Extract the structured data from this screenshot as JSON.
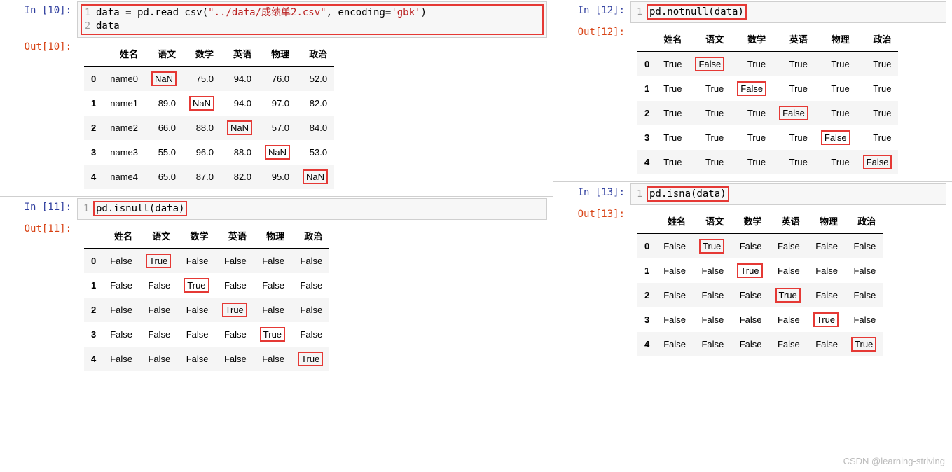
{
  "watermark": "CSDN @learning-striving",
  "cells": {
    "c10": {
      "in_label": "In  [10]:",
      "out_label": "Out[10]:",
      "code_lines": [
        {
          "n": "1",
          "pre": "data = pd.read_csv(",
          "str": "\"../data/成绩单2.csv\"",
          "mid": ", encoding=",
          "str2": "'gbk'",
          "post": ")"
        },
        {
          "n": "2",
          "pre": "data"
        }
      ],
      "cols": [
        "姓名",
        "语文",
        "数学",
        "英语",
        "物理",
        "政治"
      ],
      "rows": [
        {
          "i": "0",
          "v": [
            "name0",
            "NaN",
            "75.0",
            "94.0",
            "76.0",
            "52.0"
          ],
          "hl": [
            1
          ]
        },
        {
          "i": "1",
          "v": [
            "name1",
            "89.0",
            "NaN",
            "94.0",
            "97.0",
            "82.0"
          ],
          "hl": [
            2
          ]
        },
        {
          "i": "2",
          "v": [
            "name2",
            "66.0",
            "88.0",
            "NaN",
            "57.0",
            "84.0"
          ],
          "hl": [
            3
          ]
        },
        {
          "i": "3",
          "v": [
            "name3",
            "55.0",
            "96.0",
            "88.0",
            "NaN",
            "53.0"
          ],
          "hl": [
            4
          ]
        },
        {
          "i": "4",
          "v": [
            "name4",
            "65.0",
            "87.0",
            "82.0",
            "95.0",
            "NaN"
          ],
          "hl": [
            5
          ]
        }
      ]
    },
    "c11": {
      "in_label": "In  [11]:",
      "out_label": "Out[11]:",
      "code_lines": [
        {
          "n": "1",
          "pre": "pd.isnull(data)"
        }
      ],
      "cols": [
        "姓名",
        "语文",
        "数学",
        "英语",
        "物理",
        "政治"
      ],
      "rows": [
        {
          "i": "0",
          "v": [
            "False",
            "True",
            "False",
            "False",
            "False",
            "False"
          ],
          "hl": [
            1
          ]
        },
        {
          "i": "1",
          "v": [
            "False",
            "False",
            "True",
            "False",
            "False",
            "False"
          ],
          "hl": [
            2
          ]
        },
        {
          "i": "2",
          "v": [
            "False",
            "False",
            "False",
            "True",
            "False",
            "False"
          ],
          "hl": [
            3
          ]
        },
        {
          "i": "3",
          "v": [
            "False",
            "False",
            "False",
            "False",
            "True",
            "False"
          ],
          "hl": [
            4
          ]
        },
        {
          "i": "4",
          "v": [
            "False",
            "False",
            "False",
            "False",
            "False",
            "True"
          ],
          "hl": [
            5
          ]
        }
      ]
    },
    "c12": {
      "in_label": "In  [12]:",
      "out_label": "Out[12]:",
      "code_lines": [
        {
          "n": "1",
          "pre": "pd.notnull(data)"
        }
      ],
      "cols": [
        "姓名",
        "语文",
        "数学",
        "英语",
        "物理",
        "政治"
      ],
      "rows": [
        {
          "i": "0",
          "v": [
            "True",
            "False",
            "True",
            "True",
            "True",
            "True"
          ],
          "hl": [
            1
          ]
        },
        {
          "i": "1",
          "v": [
            "True",
            "True",
            "False",
            "True",
            "True",
            "True"
          ],
          "hl": [
            2
          ]
        },
        {
          "i": "2",
          "v": [
            "True",
            "True",
            "True",
            "False",
            "True",
            "True"
          ],
          "hl": [
            3
          ]
        },
        {
          "i": "3",
          "v": [
            "True",
            "True",
            "True",
            "True",
            "False",
            "True"
          ],
          "hl": [
            4
          ]
        },
        {
          "i": "4",
          "v": [
            "True",
            "True",
            "True",
            "True",
            "True",
            "False"
          ],
          "hl": [
            5
          ]
        }
      ]
    },
    "c13": {
      "in_label": "In  [13]:",
      "out_label": "Out[13]:",
      "code_lines": [
        {
          "n": "1",
          "pre": "pd.isna(data)"
        }
      ],
      "cols": [
        "姓名",
        "语文",
        "数学",
        "英语",
        "物理",
        "政治"
      ],
      "rows": [
        {
          "i": "0",
          "v": [
            "False",
            "True",
            "False",
            "False",
            "False",
            "False"
          ],
          "hl": [
            1
          ]
        },
        {
          "i": "1",
          "v": [
            "False",
            "False",
            "True",
            "False",
            "False",
            "False"
          ],
          "hl": [
            2
          ]
        },
        {
          "i": "2",
          "v": [
            "False",
            "False",
            "False",
            "True",
            "False",
            "False"
          ],
          "hl": [
            3
          ]
        },
        {
          "i": "3",
          "v": [
            "False",
            "False",
            "False",
            "False",
            "True",
            "False"
          ],
          "hl": [
            4
          ]
        },
        {
          "i": "4",
          "v": [
            "False",
            "False",
            "False",
            "False",
            "False",
            "True"
          ],
          "hl": [
            5
          ]
        }
      ]
    }
  }
}
